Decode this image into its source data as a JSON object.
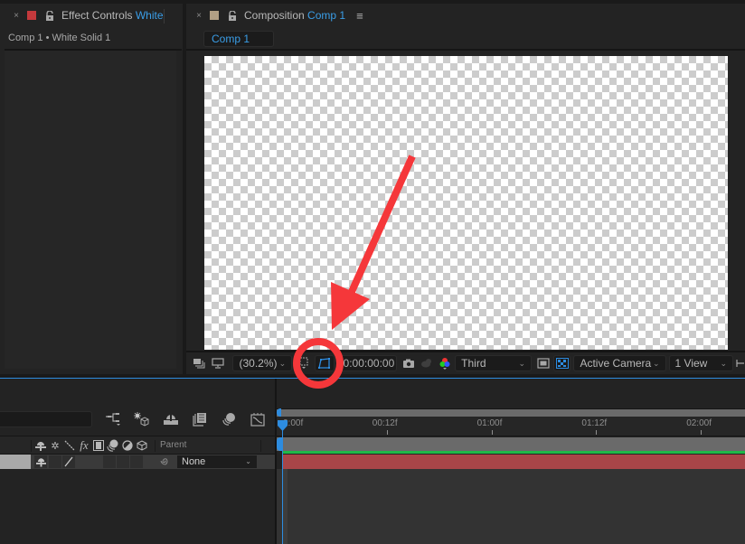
{
  "effect_controls": {
    "close": "×",
    "title_prefix": "Effect Controls",
    "title_accent": "White",
    "swatch_color": "#c4393c",
    "subtitle": "Comp 1 • White Solid 1"
  },
  "composition": {
    "close": "×",
    "title_prefix": "Composition",
    "title_accent": "Comp 1",
    "swatch_color": "#b19f84",
    "menu": "≡",
    "active_comp_chip": "Comp 1"
  },
  "viewer_toolbar": {
    "zoom_level": "(30.2%)",
    "timecode": "0:00:00:00",
    "resolution": "Third",
    "view_mode": "Active Camera",
    "views": "1 View",
    "chevron": "⌄"
  },
  "timeline": {
    "parent_header": "Parent",
    "parent_value": "None",
    "ruler": [
      {
        "label": "0:00f",
        "frame": 0
      },
      {
        "label": "00:12f",
        "frame": 12
      },
      {
        "label": "01:00f",
        "frame": 24
      },
      {
        "label": "01:12f",
        "frame": 36
      },
      {
        "label": "02:00f",
        "frame": 48
      }
    ],
    "current_frame": 0,
    "switch_header_icons": [
      "shy-icon",
      "collapse-icon",
      "quality-icon",
      "effects-icon",
      "frame-blend-icon",
      "motion-blur-icon",
      "adjustment-icon",
      "3d-layer-icon"
    ],
    "tools": [
      "composition-flowchart-icon",
      "draft-3d-icon",
      "shy-layers-icon",
      "frame-blending-icon",
      "motion-blur-icon",
      "graph-editor-icon"
    ]
  },
  "colors": {
    "accent": "#3a9ee8",
    "layer_bar": "#a84548",
    "green_bar": "#1fb848",
    "annotation": "#f5373a"
  },
  "annotation": {
    "type": "arrow-and-circle",
    "target": "toggle-mask-and-shape-path-visibility-button"
  }
}
